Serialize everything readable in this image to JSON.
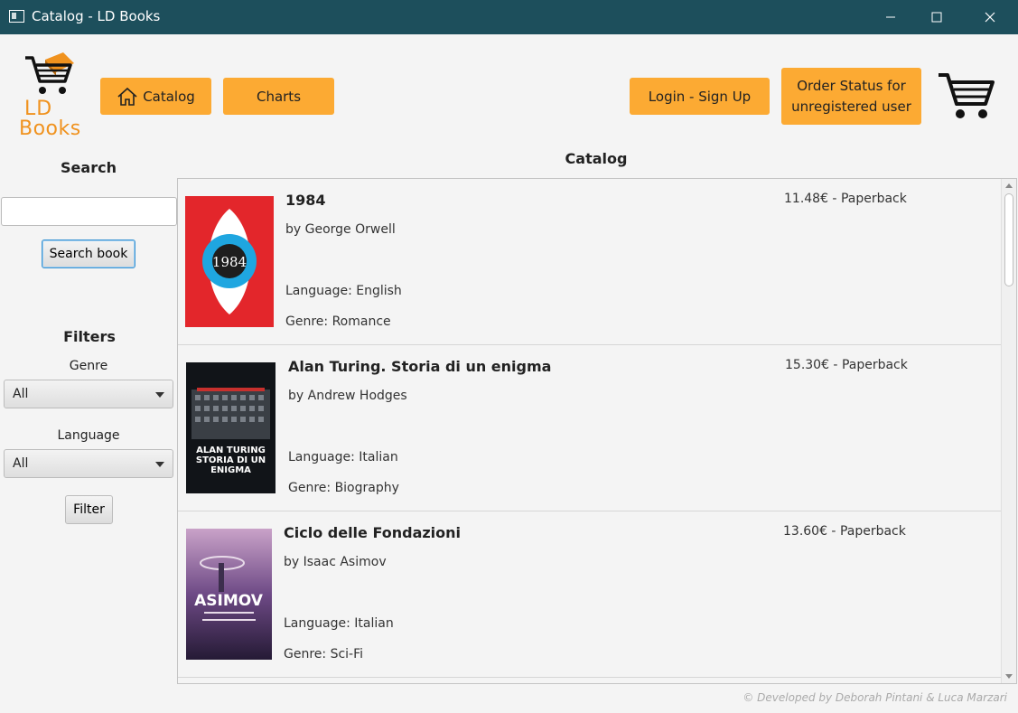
{
  "window": {
    "title": "Catalog - LD Books"
  },
  "logo": {
    "line1": "LD",
    "line2": "Books"
  },
  "nav": {
    "catalog": "Catalog",
    "charts": "Charts",
    "login": "Login - Sign Up",
    "order_line1": "Order Status for",
    "order_line2": "unregistered user"
  },
  "sidebar": {
    "search_heading": "Search",
    "search_value": "",
    "search_button": "Search book",
    "filters_heading": "Filters",
    "genre_label": "Genre",
    "genre_value": "All",
    "language_label": "Language",
    "language_value": "All",
    "filter_button": "Filter"
  },
  "catalog": {
    "heading": "Catalog",
    "books": [
      {
        "title": "1984",
        "author": "by George Orwell",
        "language": "Language: English",
        "genre": "Genre: Romance",
        "price": "11.48€ - Paperback",
        "cover_text": "1984"
      },
      {
        "title": "Alan Turing. Storia di un enigma",
        "author": "by Andrew Hodges",
        "language": "Language: Italian",
        "genre": "Genre: Biography",
        "price": "15.30€ - Paperback",
        "cover_text": "ALAN TURING STORIA DI UN ENIGMA"
      },
      {
        "title": "Ciclo delle Fondazioni",
        "author": "by Isaac Asimov",
        "language": "Language: Italian",
        "genre": "Genre: Sci-Fi",
        "price": "13.60€ - Paperback",
        "cover_text": "ASIMOV"
      }
    ]
  },
  "footer": "© Developed by Deborah Pintani & Luca Marzari",
  "colors": {
    "titlebar": "#1d4f5c",
    "accent": "#fcaa33",
    "logo": "#f0921e"
  }
}
